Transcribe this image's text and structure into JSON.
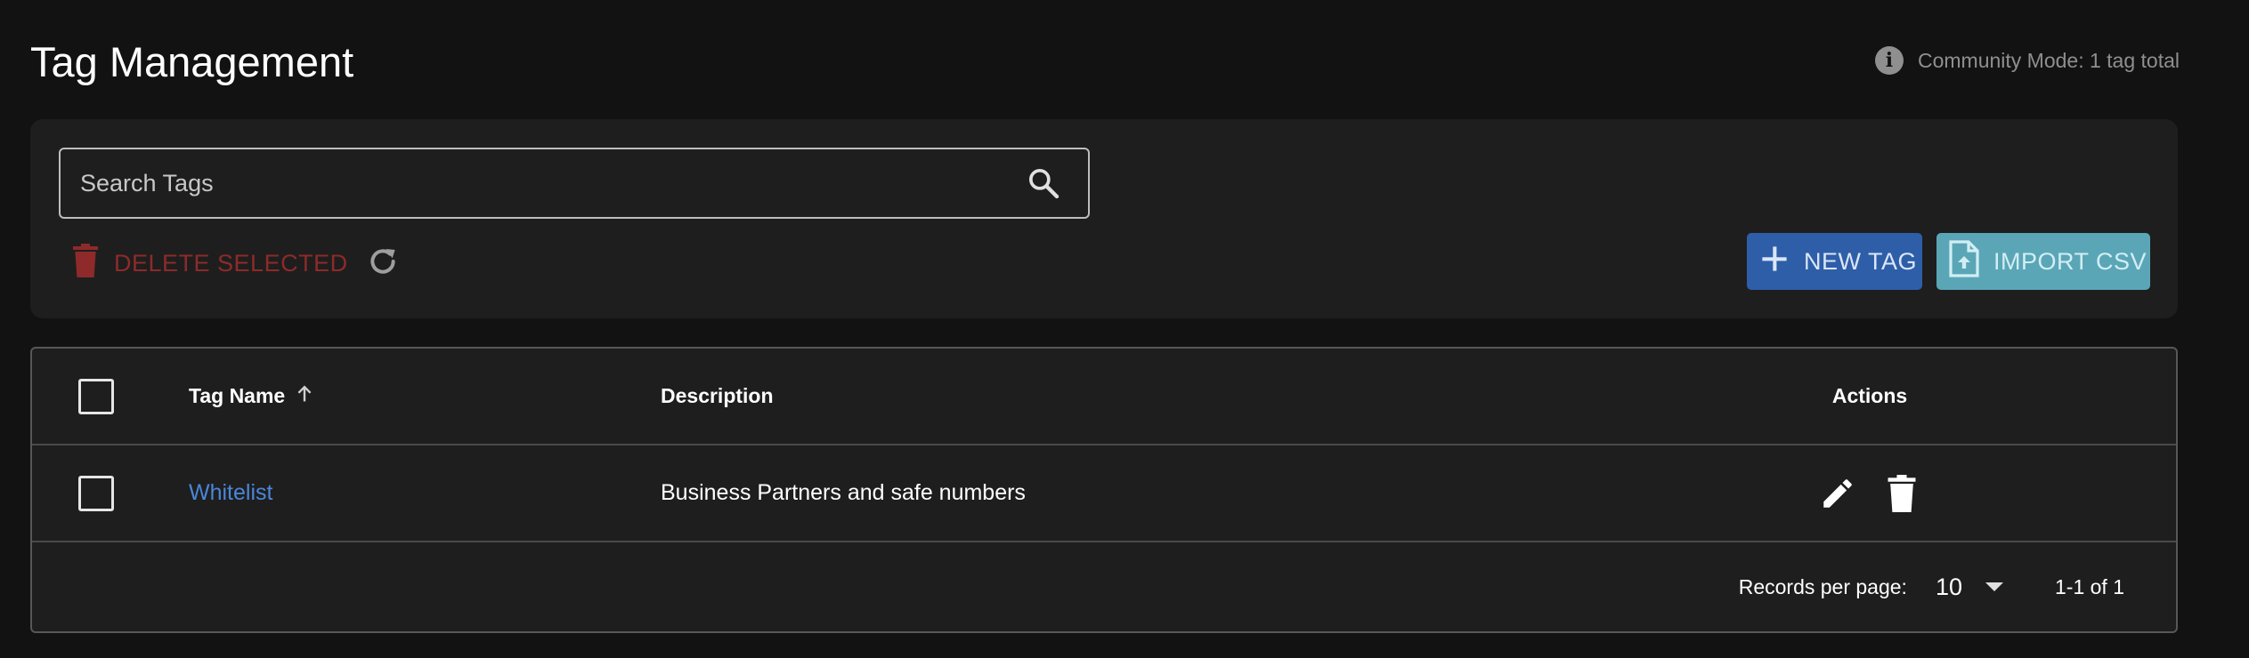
{
  "header": {
    "title": "Tag Management",
    "info_text": "Community Mode: 1 tag total"
  },
  "toolbar": {
    "search_placeholder": "Search Tags",
    "search_value": "",
    "delete_selected_label": "DELETE SELECTED",
    "new_tag_label": "NEW TAG",
    "import_csv_label": "IMPORT CSV"
  },
  "table": {
    "columns": {
      "name": "Tag Name",
      "description": "Description",
      "actions": "Actions"
    },
    "sort": {
      "column": "name",
      "direction": "asc"
    },
    "rows": [
      {
        "name": "Whitelist",
        "description": "Business Partners and safe numbers",
        "selected": false
      }
    ]
  },
  "pagination": {
    "records_per_page_label": "Records per page:",
    "records_per_page": "10",
    "range": "1-1 of 1"
  },
  "colors": {
    "background": "#121212",
    "panel": "#1e1e1e",
    "delete_red": "#8e2a2a",
    "new_tag_blue": "#2e5ea8",
    "import_teal": "#5aa6b7",
    "link_blue": "#4a86d9"
  },
  "icons": {
    "info": "info-icon",
    "search": "search-icon",
    "delete": "trash-icon",
    "refresh": "refresh-icon",
    "add": "plus-icon",
    "import": "file-upload-icon",
    "sort": "arrow-up-icon",
    "edit": "pencil-icon",
    "caret": "caret-down-icon"
  }
}
